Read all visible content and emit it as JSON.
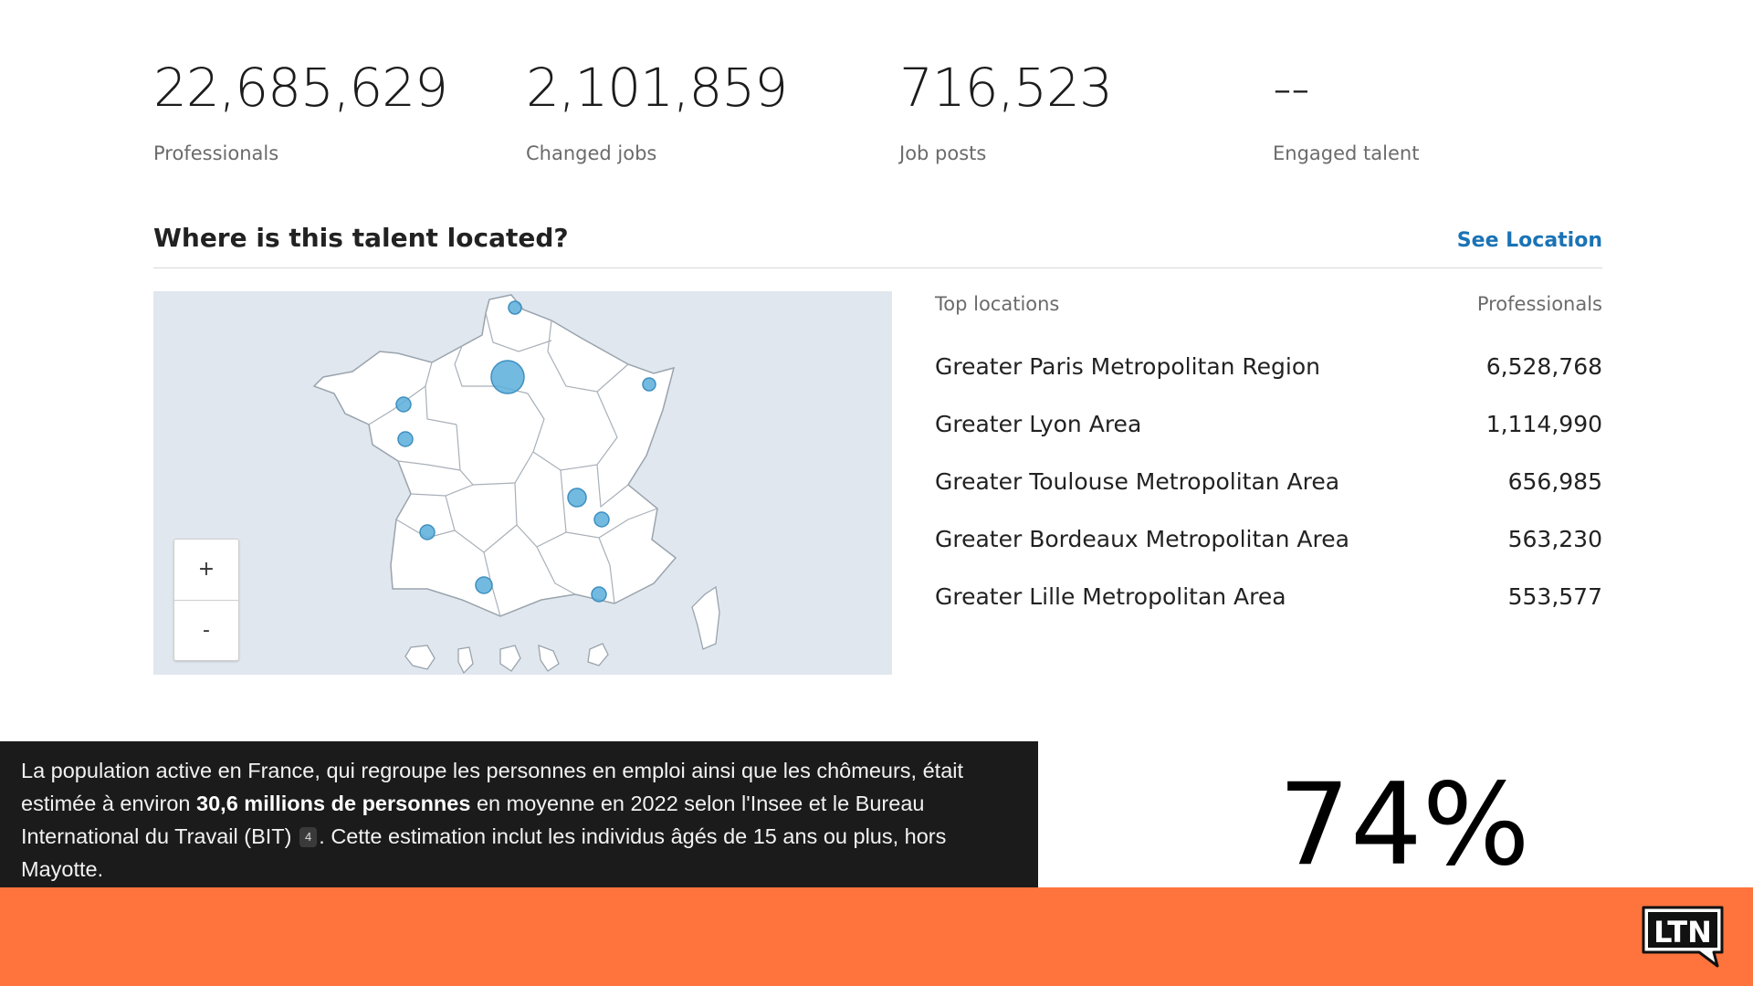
{
  "stats": [
    {
      "value": "22,685,629",
      "label": "Professionals"
    },
    {
      "value": "2,101,859",
      "label": "Changed jobs"
    },
    {
      "value": "716,523",
      "label": "Job posts"
    },
    {
      "value": "--",
      "label": "Engaged talent"
    }
  ],
  "location_section": {
    "title": "Where is this talent located?",
    "see_location": "See Location",
    "col_locations": "Top locations",
    "col_professionals": "Professionals",
    "rows": [
      {
        "name": "Greater Paris Metropolitan Region",
        "count": "6,528,768"
      },
      {
        "name": "Greater Lyon Area",
        "count": "1,114,990"
      },
      {
        "name": "Greater Toulouse Metropolitan Area",
        "count": "656,985"
      },
      {
        "name": "Greater Bordeaux Metropolitan Area",
        "count": "563,230"
      },
      {
        "name": "Greater Lille Metropolitan Area",
        "count": "553,577"
      }
    ],
    "zoom_in": "+",
    "zoom_out": "-"
  },
  "caption": {
    "part1": "La population active en France, qui regroupe les personnes en emploi ainsi que les chômeurs, était estimée à environ ",
    "bold": "30,6 millions de personnes",
    "part2": " en moyenne en 2022 selon l'Insee et le Bureau International du Travail (BIT) ",
    "ref": "4",
    "part3": ". Cette estimation inclut les individus âgés de 15 ans ou plus, hors Mayotte."
  },
  "big_percent": "74%",
  "logo_text": "LTN",
  "colors": {
    "accent_orange": "#ff743d",
    "link_blue": "#1a73b5",
    "marker_blue": "#5aaedc",
    "map_bg": "#e1e7ee"
  }
}
